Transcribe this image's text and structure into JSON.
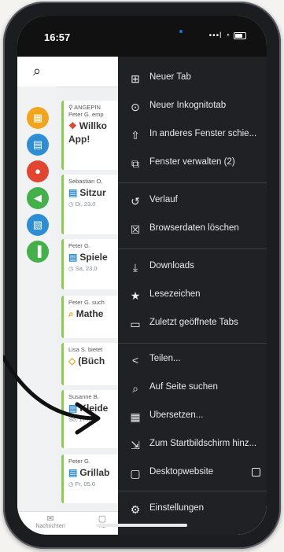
{
  "status": {
    "time": "16:57",
    "signal": "•••l",
    "wifi": "◔"
  },
  "categories": [
    {
      "name": "category-grid",
      "color": "#f2a51a",
      "glyph": "▦"
    },
    {
      "name": "category-calendar",
      "color": "#2e8ed4",
      "glyph": "▤"
    },
    {
      "name": "category-idea",
      "color": "#e2452f",
      "glyph": "●"
    },
    {
      "name": "category-megaphone",
      "color": "#43b049",
      "glyph": "◀"
    },
    {
      "name": "category-map",
      "color": "#2e8ed4",
      "glyph": "▧"
    },
    {
      "name": "category-chart",
      "color": "#43b049",
      "glyph": "▐"
    }
  ],
  "cards": [
    {
      "who": "⚲ ANGEPIN",
      "who2": "Peter G. emp",
      "icon": "❖",
      "title": "Willko",
      "title2": "App!",
      "sub": ""
    },
    {
      "who": "Sebastian O.",
      "icon": "▤",
      "title": "Sitzur",
      "sub": "◷ Di, 23.0"
    },
    {
      "who": "Peter G.",
      "icon": "▤",
      "title": "Spiele",
      "sub": "◷ Sa, 23.0"
    },
    {
      "who": "Peter G. such",
      "icon": "⌕",
      "title": "Mathe",
      "sub": ""
    },
    {
      "who": "Lisa S. bietet",
      "icon": "◇",
      "title": "(Büch",
      "sub": ""
    },
    {
      "who": "Susanne B.",
      "icon": "▤",
      "title": "Kleide",
      "sub": "So, 17.0"
    },
    {
      "who": "Peter G.",
      "icon": "▤",
      "title": "Grillab",
      "sub": "◷ Fr, 05.0"
    }
  ],
  "bottomnav": {
    "messages": "Nachrichten",
    "second": "Ka"
  },
  "menu": {
    "items": [
      {
        "name": "new-tab",
        "icon": "⊞",
        "label": "Neuer Tab"
      },
      {
        "name": "new-incognito-tab",
        "icon": "⊙",
        "label": "Neuer Inkognitotab"
      },
      {
        "name": "move-to-other-window",
        "icon": "⇧",
        "label": "In anderes Fenster schie..."
      },
      {
        "name": "manage-windows",
        "icon": "⧉",
        "label": "Fenster verwalten (2)"
      },
      {
        "name": "history",
        "icon": "↺",
        "label": "Verlauf"
      },
      {
        "name": "clear-browsing-data",
        "icon": "☒",
        "label": "Browserdaten löschen"
      },
      {
        "name": "downloads",
        "icon": "⤓",
        "label": "Downloads"
      },
      {
        "name": "bookmarks",
        "icon": "★",
        "label": "Lesezeichen"
      },
      {
        "name": "recent-tabs",
        "icon": "▭",
        "label": "Zuletzt geöffnete Tabs"
      },
      {
        "name": "share",
        "icon": "<",
        "label": "Teilen..."
      },
      {
        "name": "find-in-page",
        "icon": "⌕",
        "label": "Auf Seite suchen"
      },
      {
        "name": "translate",
        "icon": "▦",
        "label": "Übersetzen..."
      },
      {
        "name": "add-to-home-screen",
        "icon": "⇲",
        "label": "Zum Startbildschirm hinz..."
      },
      {
        "name": "desktop-site",
        "icon": "▢",
        "label": "Desktopwebsite",
        "checkbox": false
      },
      {
        "name": "settings",
        "icon": "⚙",
        "label": "Einstellungen"
      }
    ]
  },
  "colors": {
    "menu_bg": "#202124",
    "accent_green": "#8ccc4c",
    "arrow": "#111111"
  }
}
